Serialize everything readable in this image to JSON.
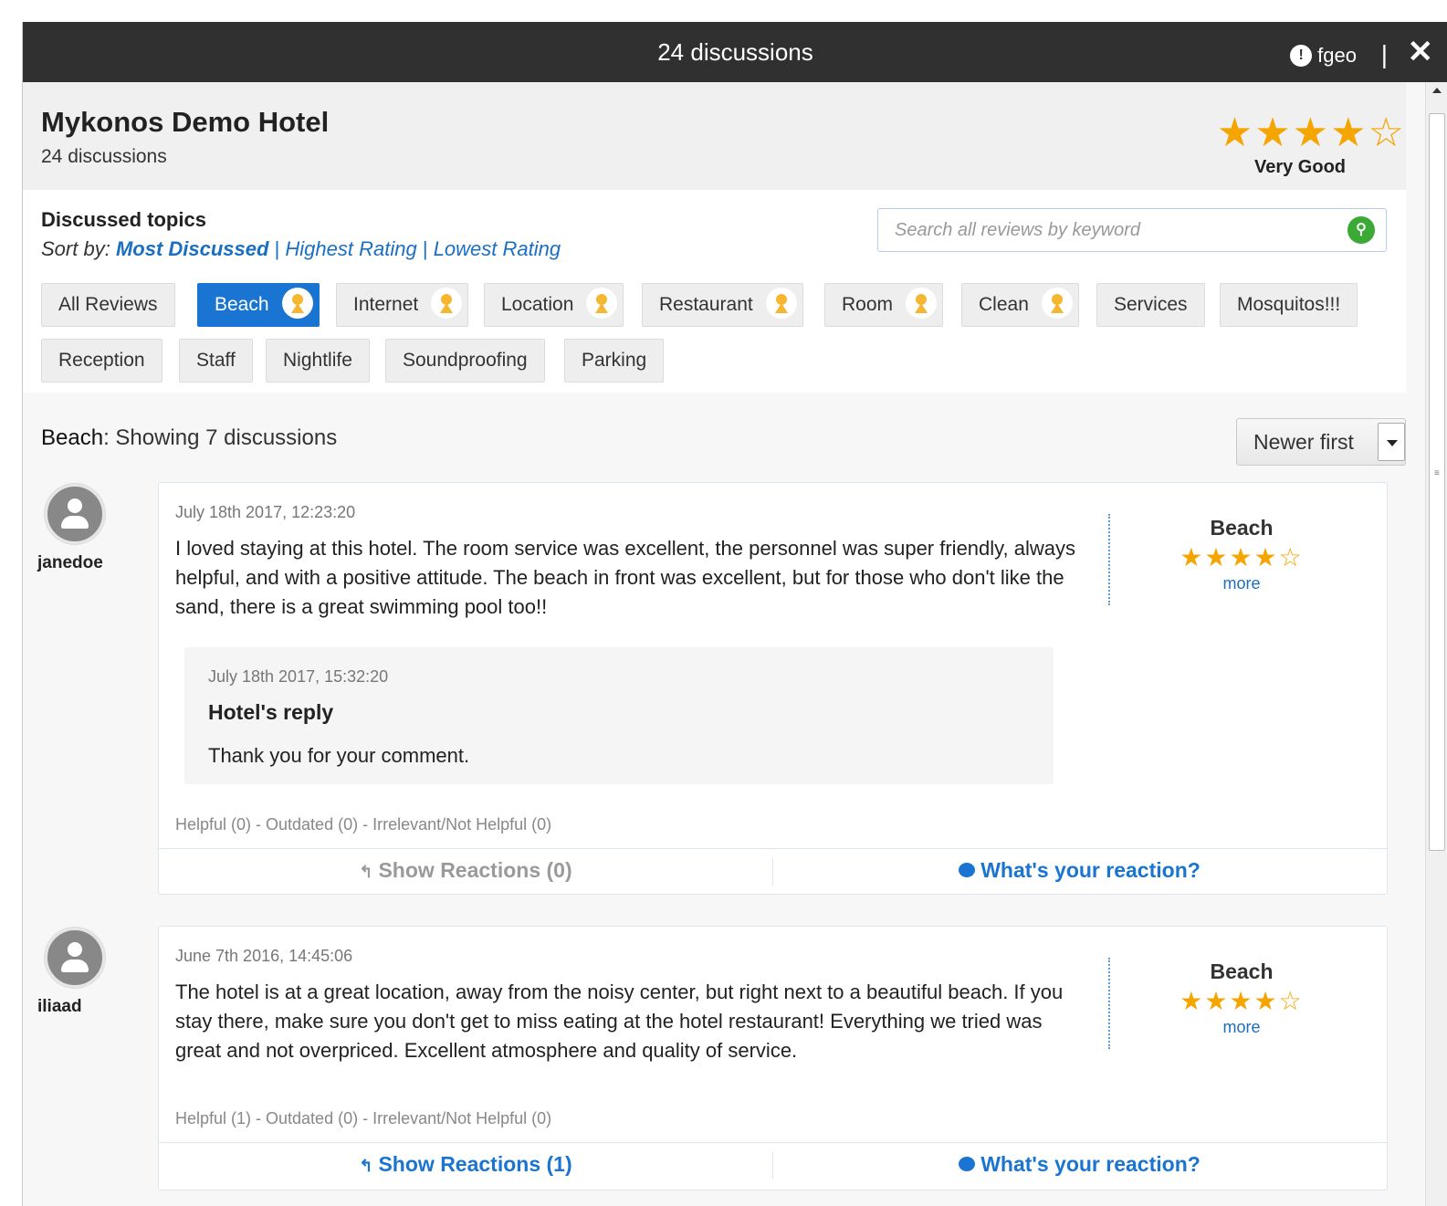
{
  "titlebar": {
    "title": "24 discussions",
    "username": "fgeo",
    "separator": "|",
    "close_icon": "close-icon"
  },
  "hotel": {
    "name": "Mykonos Demo Hotel",
    "discussions": "24 discussions",
    "stars": "★★★★☆",
    "rating": 4,
    "rating_label": "Very Good"
  },
  "topics": {
    "title": "Discussed topics",
    "sort_prefix": "Sort by:",
    "sort_options": [
      "Most Discussed",
      "Highest Rating",
      "Lowest Rating"
    ],
    "separator": "|",
    "search_placeholder": "Search all reviews by keyword",
    "chips": [
      {
        "label": "All Reviews",
        "badge": false,
        "active": false
      },
      {
        "label": "Beach",
        "badge": true,
        "active": true
      },
      {
        "label": "Internet",
        "badge": true,
        "active": false
      },
      {
        "label": "Location",
        "badge": true,
        "active": false
      },
      {
        "label": "Restaurant",
        "badge": true,
        "active": false
      },
      {
        "label": "Room",
        "badge": true,
        "active": false
      },
      {
        "label": "Clean",
        "badge": true,
        "active": false
      },
      {
        "label": "Services",
        "badge": false,
        "active": false
      },
      {
        "label": "Mosquitos!!!",
        "badge": false,
        "active": false
      },
      {
        "label": "Reception",
        "badge": false,
        "active": false
      },
      {
        "label": "Staff",
        "badge": false,
        "active": false
      },
      {
        "label": "Nightlife",
        "badge": false,
        "active": false
      },
      {
        "label": "Soundproofing",
        "badge": false,
        "active": false
      },
      {
        "label": "Parking",
        "badge": false,
        "active": false
      }
    ]
  },
  "filter": {
    "topic": "Beach",
    "text": ": Showing 7 discussions",
    "sort_selected": "Newer first"
  },
  "reviews": [
    {
      "user": "janedoe",
      "date": "July 18th 2017, 12:23:20",
      "text": "I loved staying at this hotel. The room service was excellent, the personnel was super friendly, always helpful, and with a positive attitude. The beach in front was excellent, but for those who don't like the sand, there is a great swimming pool too!!",
      "topic": "Beach",
      "stars": "★★★★☆",
      "rating": 4,
      "more": "more",
      "reply": {
        "date": "July 18th 2017, 15:32:20",
        "title": "Hotel's reply",
        "text": "Thank you for your comment."
      },
      "feedback": "Helpful (0) - Outdated (0) - Irrelevant/Not Helpful (0)",
      "show_reactions": "Show Reactions (0)",
      "reaction_prompt": "What's your reaction?"
    },
    {
      "user": "iliaad",
      "date": "June 7th 2016, 14:45:06",
      "text": "The hotel is at a great location, away from the noisy center, but right next to a beautiful beach. If you stay there, make sure you don't get to miss eating at the hotel restaurant! Everything we tried was great and not overpriced. Excellent atmosphere and quality of service.",
      "topic": "Beach",
      "stars": "★★★★☆",
      "rating": 4,
      "more": "more",
      "feedback": "Helpful (1) - Outdated (0) - Irrelevant/Not Helpful (0)",
      "show_reactions": "Show Reactions (1)",
      "reaction_prompt": "What's your reaction?"
    }
  ]
}
